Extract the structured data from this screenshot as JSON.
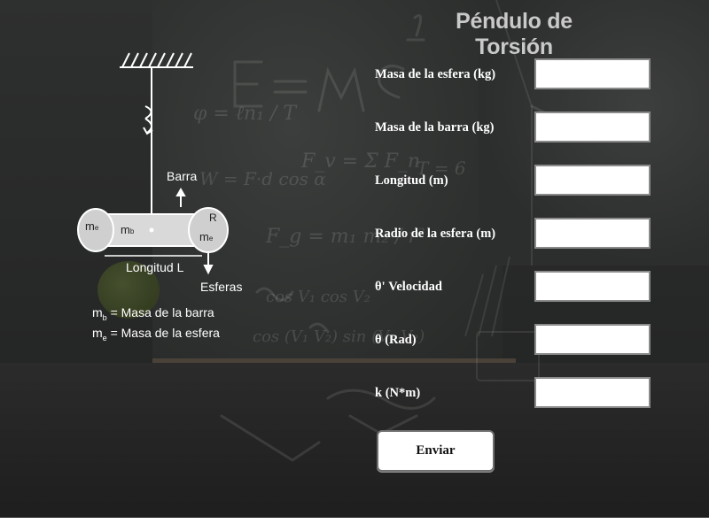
{
  "app": {
    "title": "Péndulo de Torsión"
  },
  "diagram": {
    "label_barra": "Barra",
    "label_mb": "m",
    "label_mb_sub": "b",
    "label_me_left": "m",
    "label_me_left_sub": "e",
    "label_R": "R",
    "label_me_right": "m",
    "label_me_right_sub": "e",
    "label_longitud": "Longitud L",
    "label_esferas": "Esferas",
    "legend": [
      {
        "symbol": "m",
        "sub": "b",
        "text": "= Masa de la barra"
      },
      {
        "symbol": "m",
        "sub": "e",
        "text": "= Masa de la esfera"
      }
    ]
  },
  "form": {
    "fields": [
      {
        "label": "Masa de la esfera (kg)",
        "value": "",
        "placeholder": ""
      },
      {
        "label": "Masa de la barra (kg)",
        "value": "",
        "placeholder": ""
      },
      {
        "label": "Longitud (m)",
        "value": "",
        "placeholder": ""
      },
      {
        "label": "Radio de la esfera (m)",
        "value": "",
        "placeholder": ""
      },
      {
        "label": "θ' Velocidad",
        "value": "",
        "placeholder": ""
      },
      {
        "label": "θ (Rad)",
        "value": "",
        "placeholder": ""
      },
      {
        "label": "k (N*m)",
        "value": "",
        "placeholder": ""
      }
    ],
    "submit_label": "Enviar"
  },
  "colors": {
    "background": "#2e2f2f",
    "label_text": "#ffffff",
    "title_text": "#c9c9c9",
    "input_bg": "#ffffff"
  }
}
